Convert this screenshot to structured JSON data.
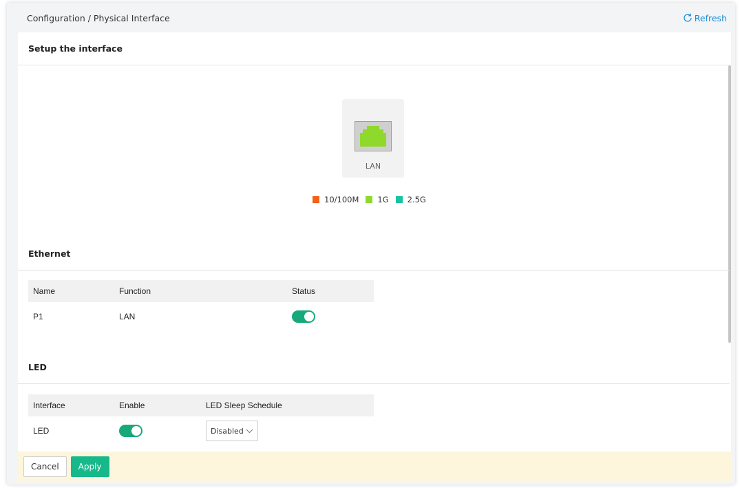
{
  "header": {
    "breadcrumb": "Configuration / Physical Interface",
    "refresh_label": "Refresh"
  },
  "setup": {
    "title": "Setup the interface",
    "port": {
      "label": "LAN",
      "color": "#8ed92b"
    },
    "legend": [
      {
        "label": "10/100M",
        "color": "#f2601a"
      },
      {
        "label": "1G",
        "color": "#8ed92b"
      },
      {
        "label": "2.5G",
        "color": "#19c2a0"
      }
    ]
  },
  "ethernet": {
    "title": "Ethernet",
    "columns": [
      "Name",
      "Function",
      "Status"
    ],
    "rows": [
      {
        "name": "P1",
        "function": "LAN",
        "status": true
      }
    ]
  },
  "led": {
    "title": "LED",
    "columns": [
      "Interface",
      "Enable",
      "LED Sleep Schedule"
    ],
    "rows": [
      {
        "interface": "LED",
        "enable": true,
        "schedule": "Disabled"
      }
    ]
  },
  "footer": {
    "cancel_label": "Cancel",
    "apply_label": "Apply"
  },
  "colors": {
    "accent": "#17b88a",
    "link": "#1a8cd8"
  }
}
